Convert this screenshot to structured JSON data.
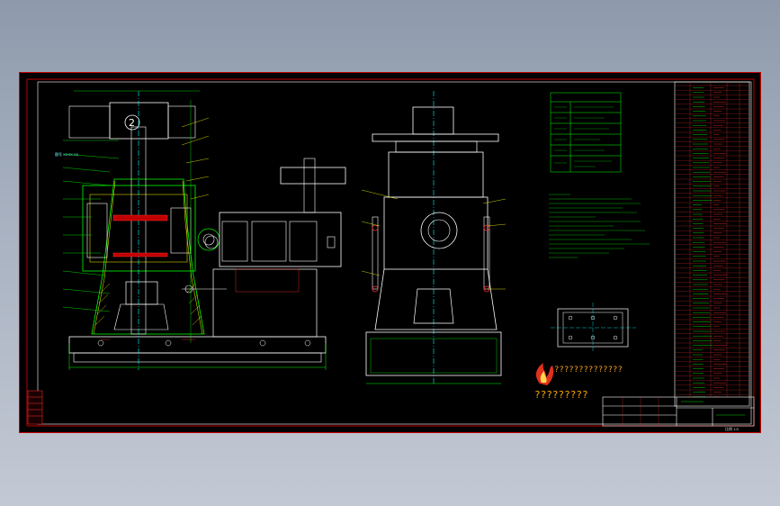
{
  "drawing": {
    "sheet_label": "图号 XXXX-XX",
    "prompt_text_1": "??????????????",
    "prompt_text_2": "?????????",
    "scale_note": "比例 1:5",
    "logo": "fire-logo-icon",
    "colors": {
      "background": "#000000",
      "frame": "#c00000",
      "part_lines": "#ffffff",
      "dimension_lines": "#00ff00",
      "center_lines": "#00ffff",
      "hatching": "#ffff00",
      "annotation": "#ff3030"
    }
  }
}
